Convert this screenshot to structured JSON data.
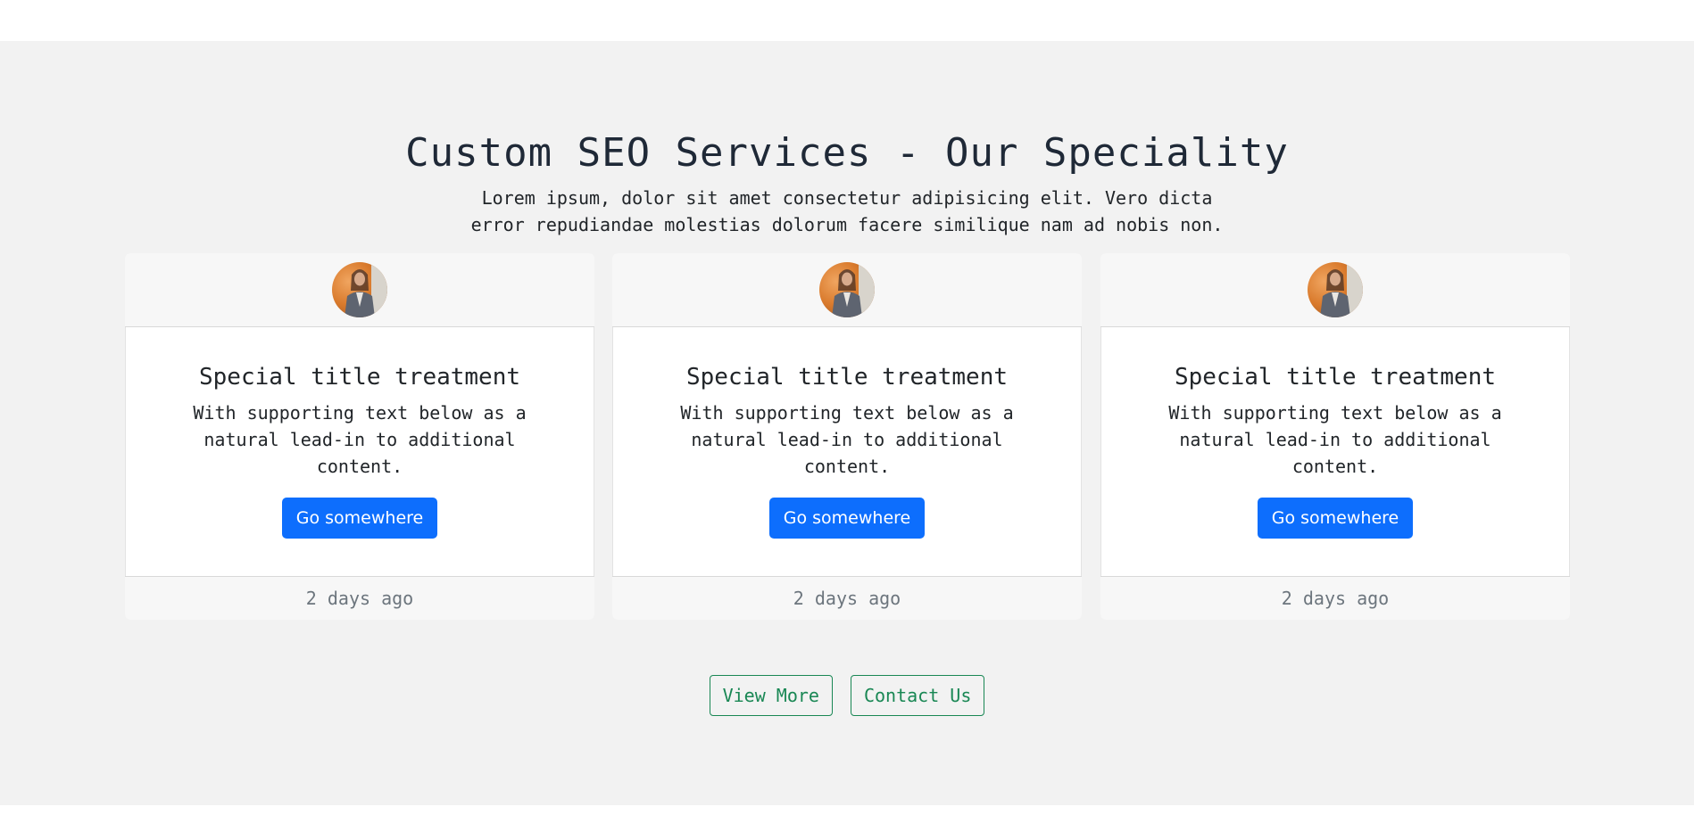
{
  "hero": {
    "title": "Custom SEO Services - Our Speciality",
    "lead": "Lorem ipsum, dolor sit amet consectetur adipisicing elit. Vero dicta error repudiandae molestias dolorum facere similique nam ad nobis non."
  },
  "cards": [
    {
      "avatar_icon": "person-avatar",
      "title": "Special title treatment",
      "text": "With supporting text below as a natural lead-in to additional content.",
      "button_label": "Go somewhere",
      "footer": "2 days ago"
    },
    {
      "avatar_icon": "person-avatar",
      "title": "Special title treatment",
      "text": "With supporting text below as a natural lead-in to additional content.",
      "button_label": "Go somewhere",
      "footer": "2 days ago"
    },
    {
      "avatar_icon": "person-avatar",
      "title": "Special title treatment",
      "text": "With supporting text below as a natural lead-in to additional content.",
      "button_label": "Go somewhere",
      "footer": "2 days ago"
    }
  ],
  "actions": {
    "view_more_label": "View More",
    "contact_label": "Contact Us"
  },
  "colors": {
    "section_bg": "#f2f2f2",
    "primary": "#0d6efd",
    "success": "#198754",
    "muted": "#6c757d"
  }
}
